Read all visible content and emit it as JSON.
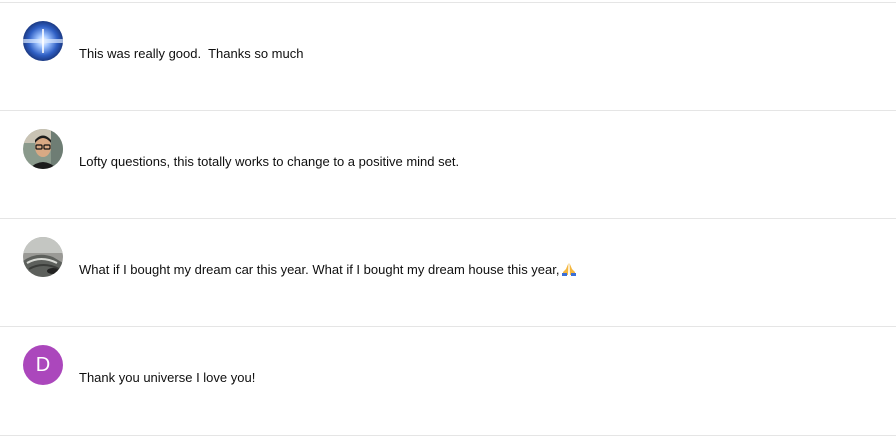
{
  "comments": [
    {
      "avatar": "abstract-blue-light-avatar",
      "text": "This was really good.  Thanks so much"
    },
    {
      "avatar": "man-with-glasses-photo-avatar",
      "text": "Lofty questions, this totally works to change to a positive mind set."
    },
    {
      "avatar": "car-photo-avatar",
      "text": "What if I bought my dream car this year. What if I bought my dream house this year,",
      "emoji": "folded-hands-emoji"
    },
    {
      "avatar": "letter-avatar",
      "avatar_letter": "D",
      "avatar_color": "#ab47bc",
      "text": "Thank you universe I love you!"
    }
  ]
}
